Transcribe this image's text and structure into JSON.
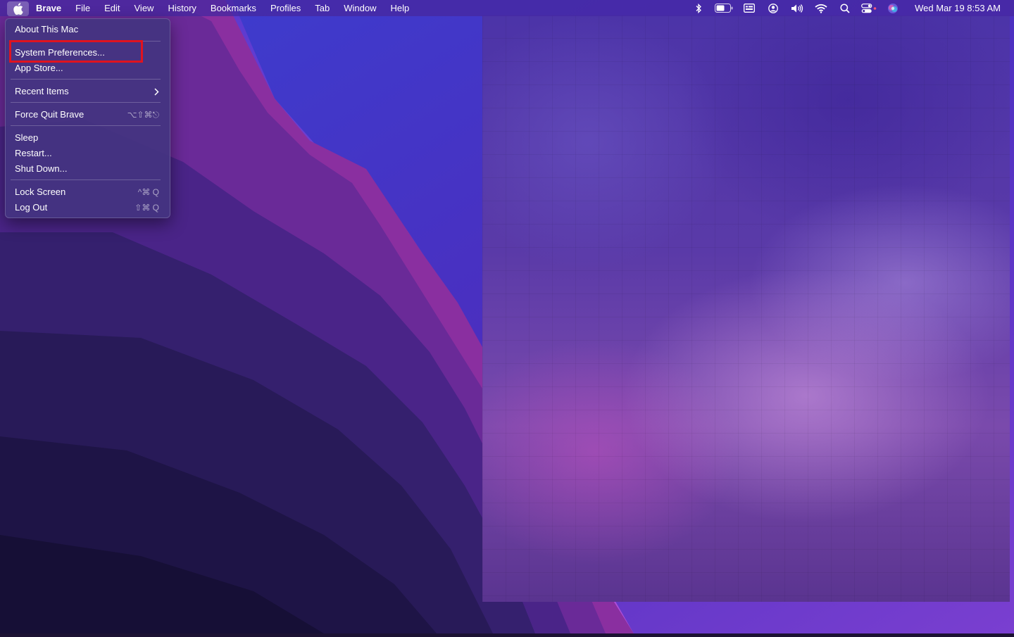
{
  "menubar": {
    "app_name": "Brave",
    "menus": [
      "File",
      "Edit",
      "View",
      "History",
      "Bookmarks",
      "Profiles",
      "Tab",
      "Window",
      "Help"
    ],
    "status_icons": [
      "bluetooth-icon",
      "battery-icon",
      "keyboard-input-icon",
      "user-icon",
      "volume-icon",
      "wifi-icon",
      "spotlight-search-icon",
      "control-center-icon",
      "siri-icon"
    ],
    "clock": "Wed Mar 19  8:53 AM"
  },
  "apple_menu": {
    "about": "About This Mac",
    "system_preferences": "System Preferences...",
    "app_store": "App Store...",
    "recent_items": "Recent Items",
    "force_quit": "Force Quit Brave",
    "force_quit_shortcut": "⌥⇧⌘⎋",
    "sleep": "Sleep",
    "restart": "Restart...",
    "shut_down": "Shut Down...",
    "lock_screen": "Lock Screen",
    "lock_screen_shortcut": "^⌘ Q",
    "log_out": "Log Out",
    "log_out_shortcut": "⇧⌘ Q"
  },
  "colors": {
    "highlight": "#e0131f",
    "menubar_bg": "#4628a0"
  }
}
